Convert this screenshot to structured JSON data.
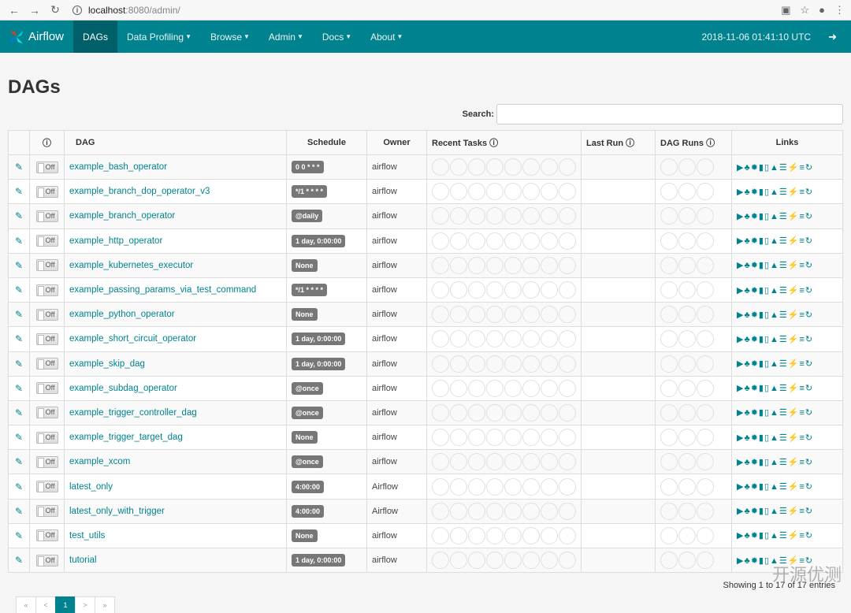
{
  "browser": {
    "url_host": "localhost",
    "url_path": ":8080/admin/"
  },
  "nav": {
    "brand": "Airflow",
    "items": [
      "DAGs",
      "Data Profiling",
      "Browse",
      "Admin",
      "Docs",
      "About"
    ],
    "timestamp": "2018-11-06 01:41:10 UTC"
  },
  "page": {
    "title": "DAGs",
    "search_label": "Search:"
  },
  "table": {
    "headers": {
      "info": "ⓘ",
      "dag": "DAG",
      "schedule": "Schedule",
      "owner": "Owner",
      "recent_tasks": "Recent Tasks",
      "last_run": "Last Run",
      "dag_runs": "DAG Runs",
      "links": "Links"
    },
    "toggle_label": "Off",
    "rows": [
      {
        "dag": "example_bash_operator",
        "schedule": "0 0 * * *",
        "owner": "airflow"
      },
      {
        "dag": "example_branch_dop_operator_v3",
        "schedule": "*/1 * * * *",
        "owner": "airflow"
      },
      {
        "dag": "example_branch_operator",
        "schedule": "@daily",
        "owner": "airflow"
      },
      {
        "dag": "example_http_operator",
        "schedule": "1 day, 0:00:00",
        "owner": "airflow"
      },
      {
        "dag": "example_kubernetes_executor",
        "schedule": "None",
        "owner": "airflow"
      },
      {
        "dag": "example_passing_params_via_test_command",
        "schedule": "*/1 * * * *",
        "owner": "airflow"
      },
      {
        "dag": "example_python_operator",
        "schedule": "None",
        "owner": "airflow"
      },
      {
        "dag": "example_short_circuit_operator",
        "schedule": "1 day, 0:00:00",
        "owner": "airflow"
      },
      {
        "dag": "example_skip_dag",
        "schedule": "1 day, 0:00:00",
        "owner": "airflow"
      },
      {
        "dag": "example_subdag_operator",
        "schedule": "@once",
        "owner": "airflow"
      },
      {
        "dag": "example_trigger_controller_dag",
        "schedule": "@once",
        "owner": "airflow"
      },
      {
        "dag": "example_trigger_target_dag",
        "schedule": "None",
        "owner": "airflow"
      },
      {
        "dag": "example_xcom",
        "schedule": "@once",
        "owner": "airflow"
      },
      {
        "dag": "latest_only",
        "schedule": "4:00:00",
        "owner": "Airflow"
      },
      {
        "dag": "latest_only_with_trigger",
        "schedule": "4:00:00",
        "owner": "Airflow"
      },
      {
        "dag": "test_utils",
        "schedule": "None",
        "owner": "airflow"
      },
      {
        "dag": "tutorial",
        "schedule": "1 day, 0:00:00",
        "owner": "airflow"
      }
    ]
  },
  "footer": {
    "showing": "Showing 1 to 17 of 17 entries",
    "pages": [
      "«",
      "<",
      "1",
      ">",
      "»"
    ]
  },
  "watermark": "开源优测",
  "colors": {
    "accent": "#00838f",
    "active_nav": "#00606a"
  }
}
